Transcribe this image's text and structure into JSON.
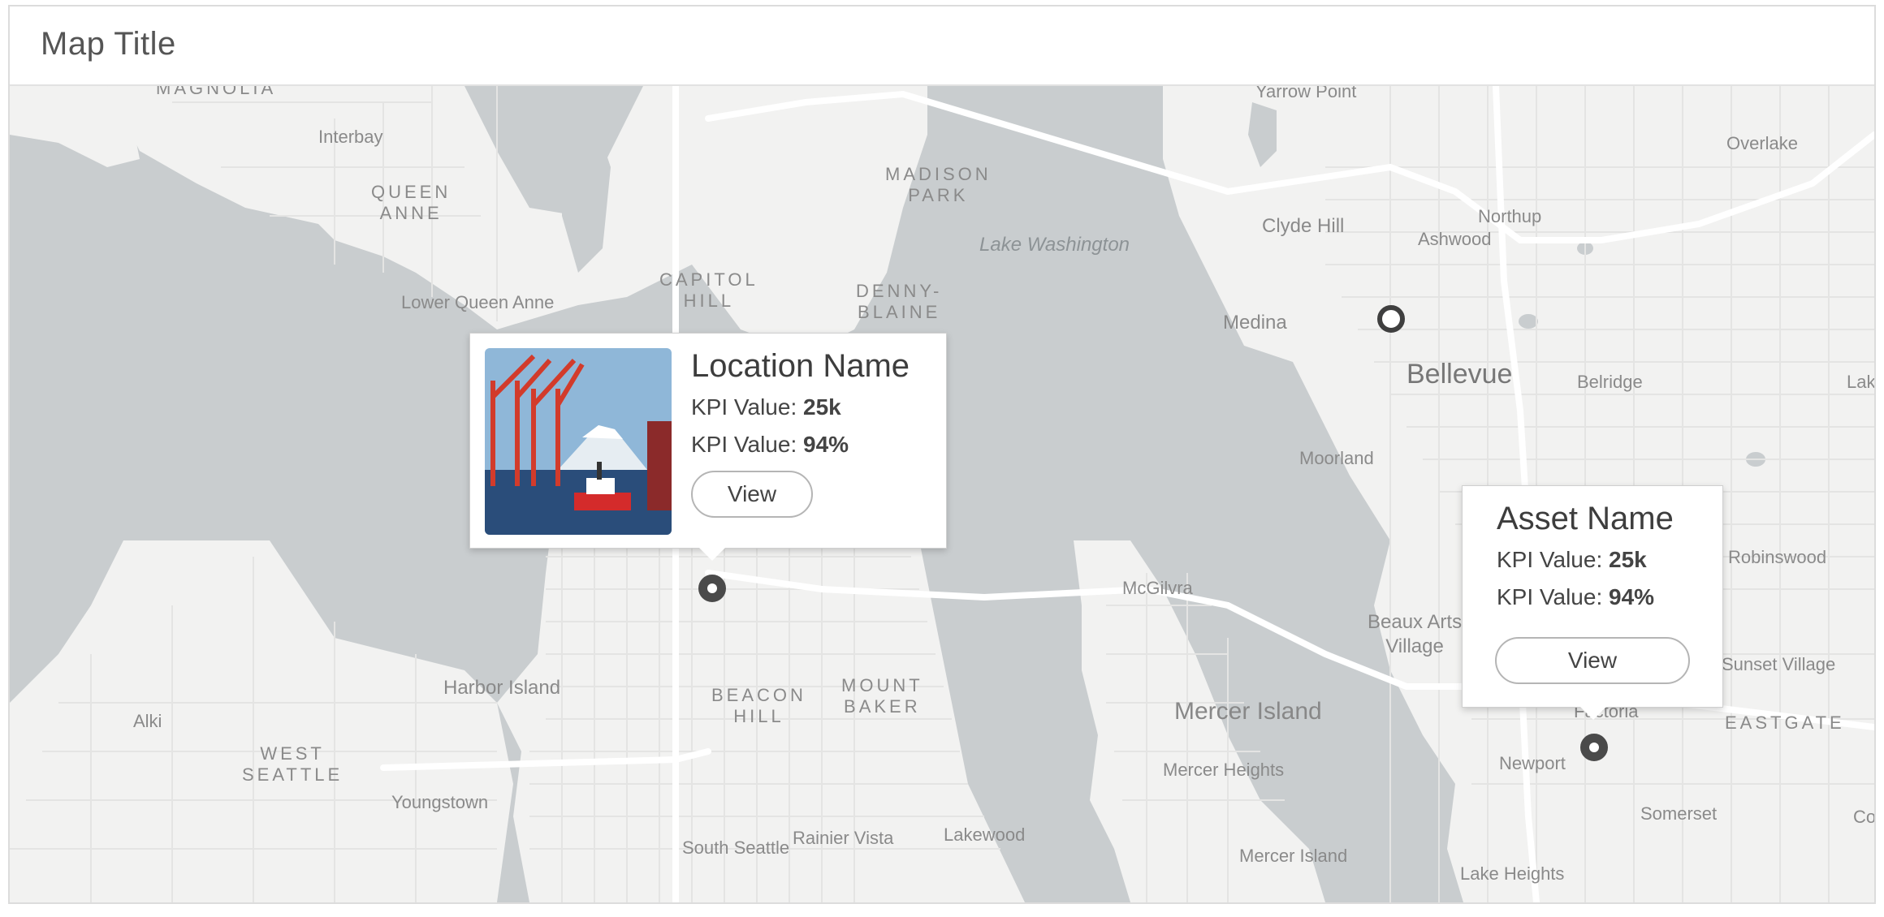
{
  "header": {
    "title": "Map Title"
  },
  "map": {
    "labels": {
      "magnolia": "MAGNOLIA",
      "interbay": "Interbay",
      "queen_anne": "QUEEN\nANNE",
      "lower_queen_anne": "Lower Queen Anne",
      "capitol_hill": "CAPITOL\nHILL",
      "madison_park": "MADISON\nPARK",
      "denny_blaine": "DENNY-\nBLAINE",
      "lake_washington": "Lake Washington",
      "yarrow_point": "Yarrow Point",
      "clyde_hill": "Clyde Hill",
      "ashwood": "Ashwood",
      "northup": "Northup",
      "overlake": "Overlake",
      "medina": "Medina",
      "bellevue": "Bellevue",
      "belridge": "Belridge",
      "lak": "Lak",
      "moorland": "Moorland",
      "robinswood": "Robinswood",
      "beaux_arts": "Beaux Arts\nVillage",
      "sunset_village": "Sunset Village",
      "eastgate": "EASTGATE",
      "factoria": "Factoria",
      "mcgilvra": "McGilvra",
      "harbor_island": "Harbor Island",
      "alki": "Alki",
      "west_seattle": "WEST\nSEATTLE",
      "beacon_hill": "BEACON\nHILL",
      "mount_baker": "MOUNT\nBAKER",
      "mercer_island": "Mercer Island",
      "mercer_heights": "Mercer Heights",
      "mercer_island_south": "Mercer Island",
      "newport": "Newport",
      "somerset": "Somerset",
      "co": "Co",
      "youngstown": "Youngstown",
      "rainier_vista": "Rainier Vista",
      "lakewood": "Lakewood",
      "south_seattle": "South Seattle",
      "lake_heights": "Lake Heights"
    }
  },
  "popup_location": {
    "title": "Location Name",
    "kpi1_label": "KPI Value: ",
    "kpi1_value": "25k",
    "kpi2_label": "KPI Value: ",
    "kpi2_value": "94%",
    "button": "View"
  },
  "popup_asset": {
    "title": "Asset Name",
    "kpi1_label": "KPI Value: ",
    "kpi1_value": "25k",
    "kpi2_label": "KPI Value: ",
    "kpi2_value": "94%",
    "button": "View"
  },
  "colors": {
    "water": "#c9cdcf",
    "land": "#f1f1f0",
    "road": "#ffffff",
    "pin": "#4a4a4a"
  }
}
